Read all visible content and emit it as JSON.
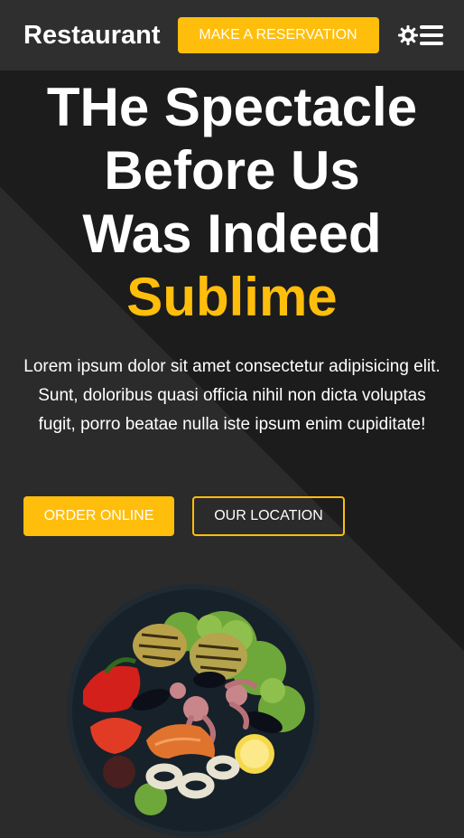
{
  "header": {
    "logo": "Restaurant",
    "reserve_label": "MAKE A RESERVATION",
    "theme_icon": "gear-icon",
    "menu_icon": "hamburger-menu-icon"
  },
  "hero": {
    "headline_line1": "THe Spectacle",
    "headline_line2": "Before Us",
    "headline_line3": "Was Indeed",
    "headline_accent": "Sublime",
    "description": "Lorem ipsum dolor sit amet consectetur adipisicing elit. Sunt, doloribus quasi officia nihil non dicta voluptas fugit, porro beatae nulla iste ipsum enim cupiditate!",
    "order_label": "ORDER ONLINE",
    "location_label": "OUR LOCATION"
  },
  "colors": {
    "accent": "#ffbe0b",
    "header_bg": "#2f2f2f",
    "page_bg": "#1c1c1c"
  }
}
